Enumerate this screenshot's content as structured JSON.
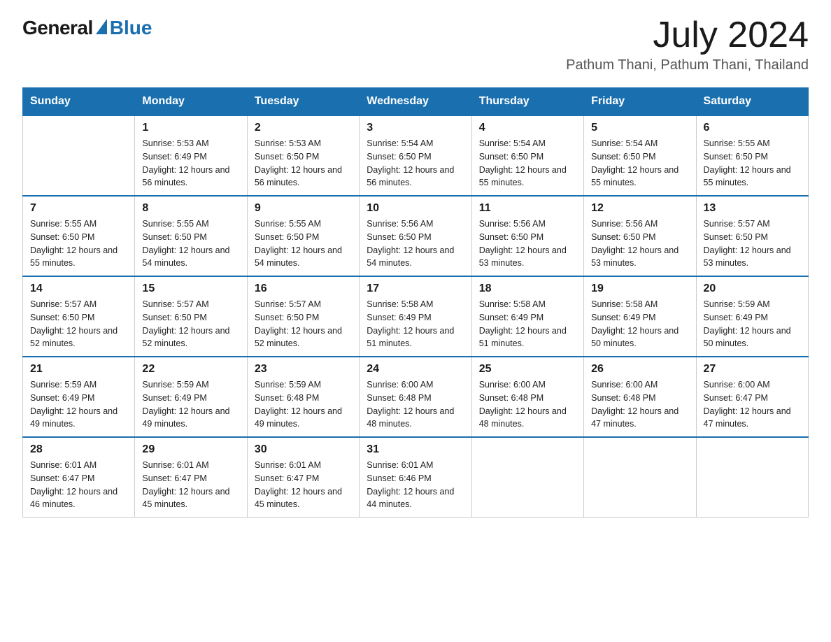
{
  "header": {
    "logo_general": "General",
    "logo_blue": "Blue",
    "month_year": "July 2024",
    "location": "Pathum Thani, Pathum Thani, Thailand"
  },
  "weekdays": [
    "Sunday",
    "Monday",
    "Tuesday",
    "Wednesday",
    "Thursday",
    "Friday",
    "Saturday"
  ],
  "weeks": [
    [
      {
        "day": "",
        "sunrise": "",
        "sunset": "",
        "daylight": ""
      },
      {
        "day": "1",
        "sunrise": "Sunrise: 5:53 AM",
        "sunset": "Sunset: 6:49 PM",
        "daylight": "Daylight: 12 hours and 56 minutes."
      },
      {
        "day": "2",
        "sunrise": "Sunrise: 5:53 AM",
        "sunset": "Sunset: 6:50 PM",
        "daylight": "Daylight: 12 hours and 56 minutes."
      },
      {
        "day": "3",
        "sunrise": "Sunrise: 5:54 AM",
        "sunset": "Sunset: 6:50 PM",
        "daylight": "Daylight: 12 hours and 56 minutes."
      },
      {
        "day": "4",
        "sunrise": "Sunrise: 5:54 AM",
        "sunset": "Sunset: 6:50 PM",
        "daylight": "Daylight: 12 hours and 55 minutes."
      },
      {
        "day": "5",
        "sunrise": "Sunrise: 5:54 AM",
        "sunset": "Sunset: 6:50 PM",
        "daylight": "Daylight: 12 hours and 55 minutes."
      },
      {
        "day": "6",
        "sunrise": "Sunrise: 5:55 AM",
        "sunset": "Sunset: 6:50 PM",
        "daylight": "Daylight: 12 hours and 55 minutes."
      }
    ],
    [
      {
        "day": "7",
        "sunrise": "Sunrise: 5:55 AM",
        "sunset": "Sunset: 6:50 PM",
        "daylight": "Daylight: 12 hours and 55 minutes."
      },
      {
        "day": "8",
        "sunrise": "Sunrise: 5:55 AM",
        "sunset": "Sunset: 6:50 PM",
        "daylight": "Daylight: 12 hours and 54 minutes."
      },
      {
        "day": "9",
        "sunrise": "Sunrise: 5:55 AM",
        "sunset": "Sunset: 6:50 PM",
        "daylight": "Daylight: 12 hours and 54 minutes."
      },
      {
        "day": "10",
        "sunrise": "Sunrise: 5:56 AM",
        "sunset": "Sunset: 6:50 PM",
        "daylight": "Daylight: 12 hours and 54 minutes."
      },
      {
        "day": "11",
        "sunrise": "Sunrise: 5:56 AM",
        "sunset": "Sunset: 6:50 PM",
        "daylight": "Daylight: 12 hours and 53 minutes."
      },
      {
        "day": "12",
        "sunrise": "Sunrise: 5:56 AM",
        "sunset": "Sunset: 6:50 PM",
        "daylight": "Daylight: 12 hours and 53 minutes."
      },
      {
        "day": "13",
        "sunrise": "Sunrise: 5:57 AM",
        "sunset": "Sunset: 6:50 PM",
        "daylight": "Daylight: 12 hours and 53 minutes."
      }
    ],
    [
      {
        "day": "14",
        "sunrise": "Sunrise: 5:57 AM",
        "sunset": "Sunset: 6:50 PM",
        "daylight": "Daylight: 12 hours and 52 minutes."
      },
      {
        "day": "15",
        "sunrise": "Sunrise: 5:57 AM",
        "sunset": "Sunset: 6:50 PM",
        "daylight": "Daylight: 12 hours and 52 minutes."
      },
      {
        "day": "16",
        "sunrise": "Sunrise: 5:57 AM",
        "sunset": "Sunset: 6:50 PM",
        "daylight": "Daylight: 12 hours and 52 minutes."
      },
      {
        "day": "17",
        "sunrise": "Sunrise: 5:58 AM",
        "sunset": "Sunset: 6:49 PM",
        "daylight": "Daylight: 12 hours and 51 minutes."
      },
      {
        "day": "18",
        "sunrise": "Sunrise: 5:58 AM",
        "sunset": "Sunset: 6:49 PM",
        "daylight": "Daylight: 12 hours and 51 minutes."
      },
      {
        "day": "19",
        "sunrise": "Sunrise: 5:58 AM",
        "sunset": "Sunset: 6:49 PM",
        "daylight": "Daylight: 12 hours and 50 minutes."
      },
      {
        "day": "20",
        "sunrise": "Sunrise: 5:59 AM",
        "sunset": "Sunset: 6:49 PM",
        "daylight": "Daylight: 12 hours and 50 minutes."
      }
    ],
    [
      {
        "day": "21",
        "sunrise": "Sunrise: 5:59 AM",
        "sunset": "Sunset: 6:49 PM",
        "daylight": "Daylight: 12 hours and 49 minutes."
      },
      {
        "day": "22",
        "sunrise": "Sunrise: 5:59 AM",
        "sunset": "Sunset: 6:49 PM",
        "daylight": "Daylight: 12 hours and 49 minutes."
      },
      {
        "day": "23",
        "sunrise": "Sunrise: 5:59 AM",
        "sunset": "Sunset: 6:48 PM",
        "daylight": "Daylight: 12 hours and 49 minutes."
      },
      {
        "day": "24",
        "sunrise": "Sunrise: 6:00 AM",
        "sunset": "Sunset: 6:48 PM",
        "daylight": "Daylight: 12 hours and 48 minutes."
      },
      {
        "day": "25",
        "sunrise": "Sunrise: 6:00 AM",
        "sunset": "Sunset: 6:48 PM",
        "daylight": "Daylight: 12 hours and 48 minutes."
      },
      {
        "day": "26",
        "sunrise": "Sunrise: 6:00 AM",
        "sunset": "Sunset: 6:48 PM",
        "daylight": "Daylight: 12 hours and 47 minutes."
      },
      {
        "day": "27",
        "sunrise": "Sunrise: 6:00 AM",
        "sunset": "Sunset: 6:47 PM",
        "daylight": "Daylight: 12 hours and 47 minutes."
      }
    ],
    [
      {
        "day": "28",
        "sunrise": "Sunrise: 6:01 AM",
        "sunset": "Sunset: 6:47 PM",
        "daylight": "Daylight: 12 hours and 46 minutes."
      },
      {
        "day": "29",
        "sunrise": "Sunrise: 6:01 AM",
        "sunset": "Sunset: 6:47 PM",
        "daylight": "Daylight: 12 hours and 45 minutes."
      },
      {
        "day": "30",
        "sunrise": "Sunrise: 6:01 AM",
        "sunset": "Sunset: 6:47 PM",
        "daylight": "Daylight: 12 hours and 45 minutes."
      },
      {
        "day": "31",
        "sunrise": "Sunrise: 6:01 AM",
        "sunset": "Sunset: 6:46 PM",
        "daylight": "Daylight: 12 hours and 44 minutes."
      },
      {
        "day": "",
        "sunrise": "",
        "sunset": "",
        "daylight": ""
      },
      {
        "day": "",
        "sunrise": "",
        "sunset": "",
        "daylight": ""
      },
      {
        "day": "",
        "sunrise": "",
        "sunset": "",
        "daylight": ""
      }
    ]
  ]
}
